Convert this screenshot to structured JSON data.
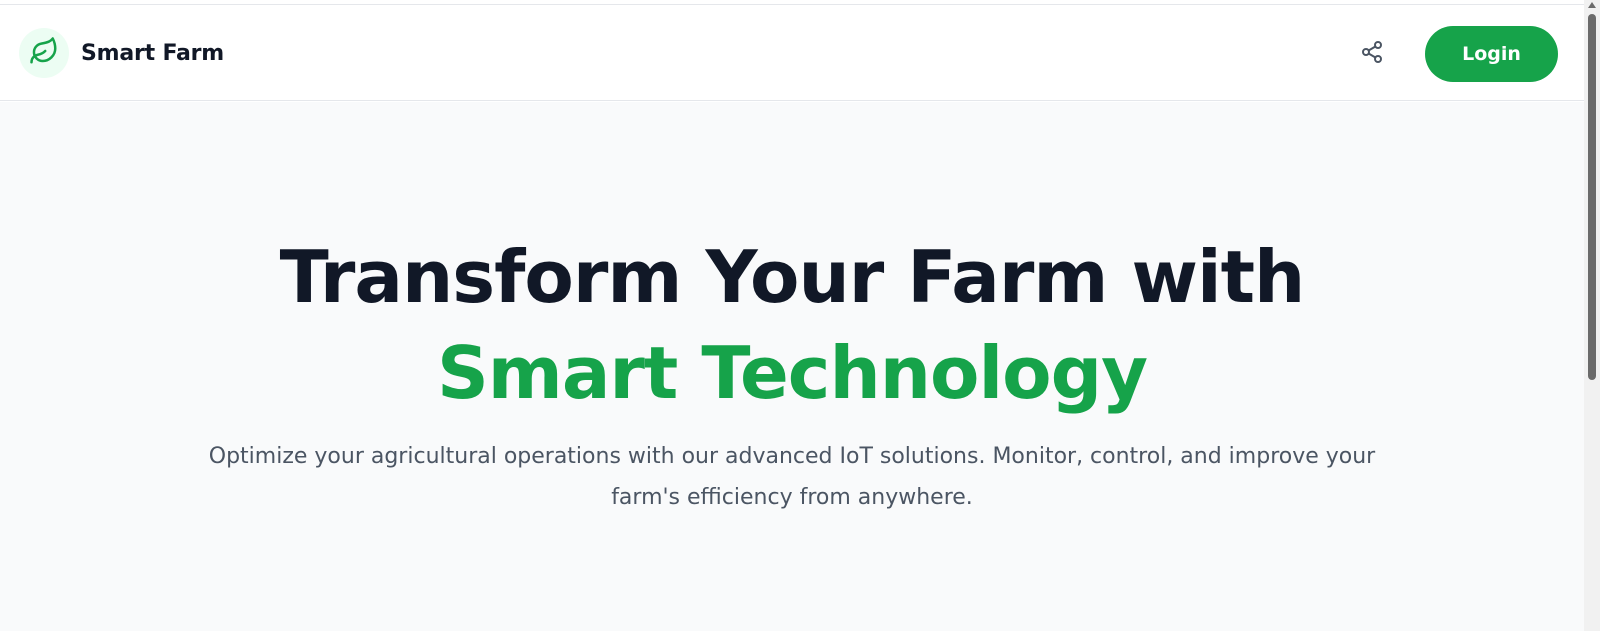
{
  "header": {
    "brand_name": "Smart Farm",
    "logo_icon": "leaf-icon",
    "share_icon": "share-icon",
    "login_label": "Login"
  },
  "hero": {
    "title_line_1": "Transform Your Farm with",
    "title_line_2": "Smart Technology",
    "subtitle": "Optimize your agricultural operations with our advanced IoT solutions. Monitor, control, and improve your farm's efficiency from anywhere."
  },
  "colors": {
    "accent": "#16a34a",
    "title_dark": "#111827",
    "subtitle_gray": "#4b5563",
    "hero_background": "#f9fafb",
    "logo_badge_background": "#ecfdf3"
  }
}
